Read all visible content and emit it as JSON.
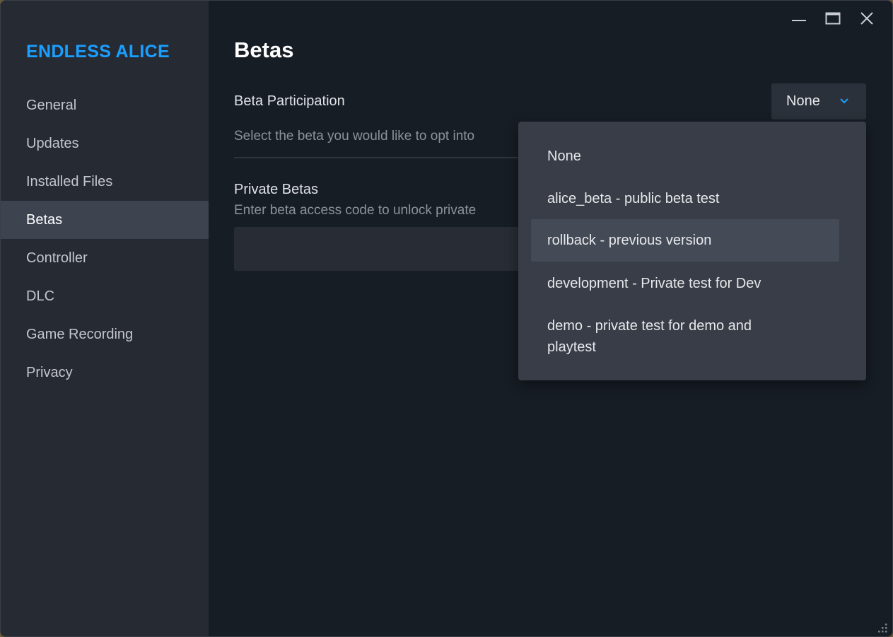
{
  "app": {
    "title": "ENDLESS ALICE"
  },
  "sidebar": {
    "items": [
      {
        "label": "General",
        "active": false
      },
      {
        "label": "Updates",
        "active": false
      },
      {
        "label": "Installed Files",
        "active": false
      },
      {
        "label": "Betas",
        "active": true
      },
      {
        "label": "Controller",
        "active": false
      },
      {
        "label": "DLC",
        "active": false
      },
      {
        "label": "Game Recording",
        "active": false
      },
      {
        "label": "Privacy",
        "active": false
      }
    ]
  },
  "page": {
    "title": "Betas",
    "beta_participation": {
      "label": "Beta Participation",
      "description": "Select the beta you would like to opt into",
      "selected": "None",
      "options": [
        "None",
        "alice_beta - public beta test",
        "rollback - previous version",
        "development - Private test for Dev",
        "demo - private test for demo and playtest"
      ],
      "highlighted_option": "rollback - previous version"
    },
    "private_betas": {
      "label": "Private Betas",
      "description": "Enter beta access code to unlock private",
      "input_value": ""
    }
  },
  "icons": {
    "minimize": "minimize-icon",
    "maximize": "maximize-icon",
    "close": "close-icon",
    "dropdown": "chevron-down-icon",
    "resize": "resize-grip-icon"
  },
  "colors": {
    "accent": "#1a9fff",
    "sidebar_bg": "#262a33",
    "main_bg": "#171d25",
    "active_item_bg": "#3d4450",
    "dropdown_bg": "#383d47"
  }
}
